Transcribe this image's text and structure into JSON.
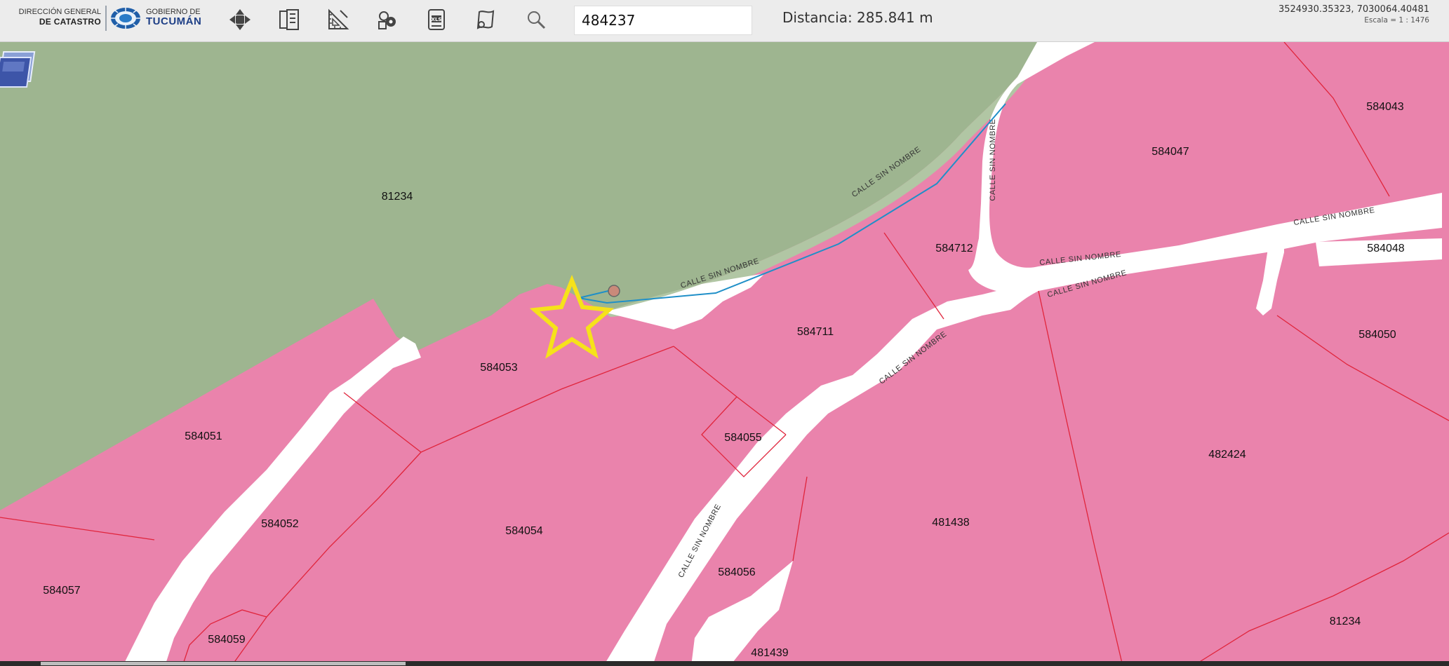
{
  "header": {
    "logo_left_line1": "DIRECCIÓN GENERAL",
    "logo_left_line2": "DE CATASTRO",
    "logo_right_line1": "GOBIERNO DE",
    "logo_right_line2": "TUCUMÁN"
  },
  "toolbar": {
    "tools": [
      {
        "name": "pan-icon"
      },
      {
        "name": "layers-panel-icon"
      },
      {
        "name": "measure-ruler-icon"
      },
      {
        "name": "identify-icon"
      },
      {
        "name": "export-excel-icon"
      },
      {
        "name": "map-sheet-icon"
      },
      {
        "name": "search-icon"
      }
    ],
    "search_value": "484237",
    "distance_text": "Distancia: 285.841 m"
  },
  "coordinates": {
    "xy": "3524930.35323, 7030064.40481",
    "scale": "Escala = 1 : 1476"
  },
  "map": {
    "colors": {
      "parcel_fill": "#ea83ac",
      "parcel_line": "#e0253c",
      "green_area": "#9eb590",
      "road": "#ffffff",
      "measure_line": "#1f8fc8",
      "star": "#f6e21a"
    },
    "parcels": [
      "81234",
      "584043",
      "584047",
      "584712",
      "584048",
      "584711",
      "584050",
      "584053",
      "584051",
      "584055",
      "482424",
      "584052",
      "584054",
      "481438",
      "584057",
      "584056",
      "81234",
      "584059",
      "481439"
    ],
    "roads": [
      "CALLE SIN NOMBRE",
      "CALLE SIN NOMBRE",
      "CALLE SIN NOMBRE",
      "CALLE SIN NOMBRE",
      "CALLE SIN NOMBRE",
      "CALLE SIN NOMBRE",
      "CALLE SIN NOMBRE",
      "CALLE SIN NOMBRE"
    ]
  }
}
